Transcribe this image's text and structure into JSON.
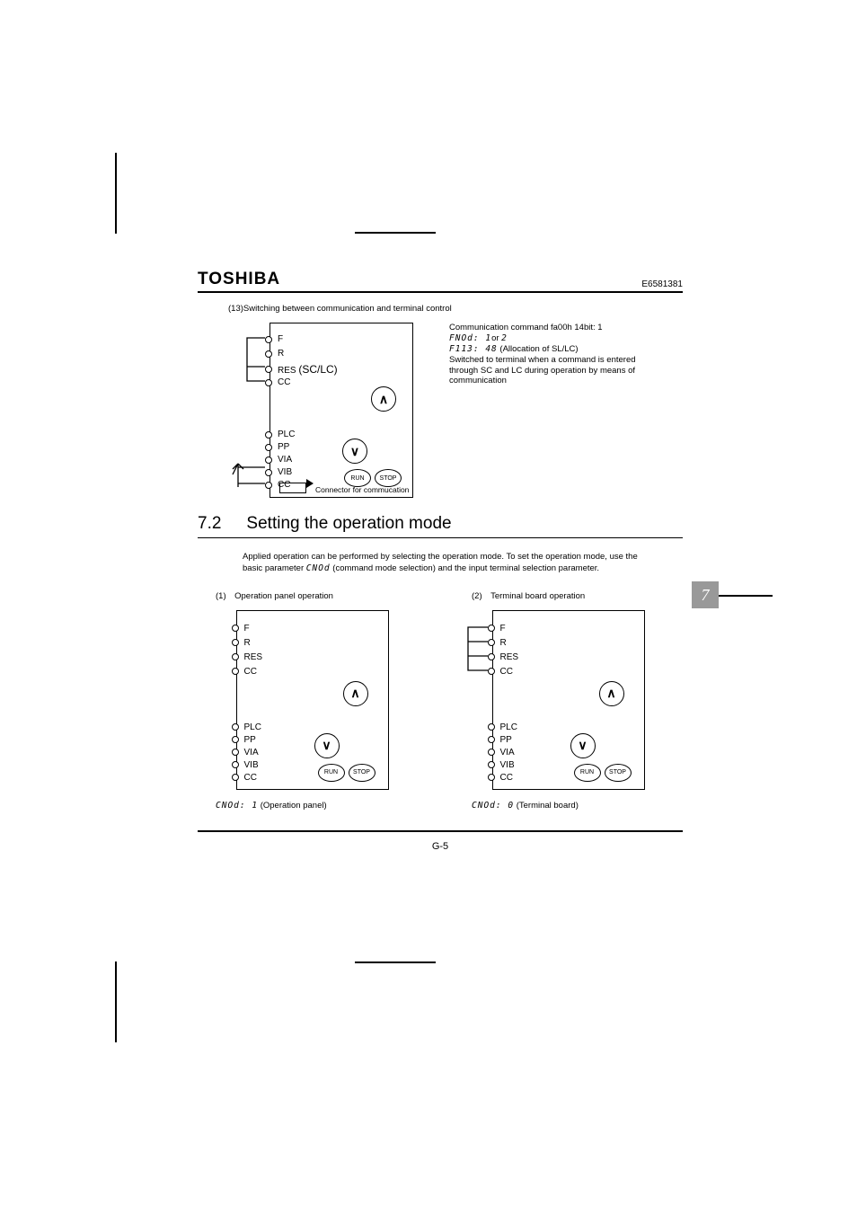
{
  "header": {
    "logo": "TOSHIBA",
    "docnum": "E6581381"
  },
  "side_tab": "7",
  "sect13_title": "(13)Switching between communication and terminal control",
  "dev13": {
    "t1": "F",
    "t2": "R",
    "t3": "RES",
    "t3b": "(SC/LC)",
    "t4": "CC",
    "t5": "PLC",
    "t6": "PP",
    "t7": "VIA",
    "t8": "VIB",
    "t9": "CC",
    "btn_run": "RUN",
    "btn_stop": "STOP",
    "conn": "Connector for commucation"
  },
  "note13": {
    "l1": "Communication command fa00h 14bit: 1",
    "l2a": "FNOd",
    "l2b": ": 1",
    "l2c": "or",
    "l2d": "2",
    "l3a": "F113",
    "l3b": ": 48",
    "l3c": " (Allocation of SL/LC)",
    "l4": "Switched to terminal when a command is entered through SC and LC during operation by means of communication"
  },
  "h2": {
    "num": "7.2",
    "txt": "Setting the operation mode"
  },
  "para": {
    "p1a": "Applied operation can be performed by selecting the operation mode. To set the operation mode, use the basic parameter ",
    "p1b": "CNOd",
    "p1c": " (command mode selection) and the input terminal selection parameter."
  },
  "col1_title": "(1) Operation panel operation",
  "col2_title": "(2) Terminal board operation",
  "dev_generic": {
    "t1": "F",
    "t2": "R",
    "t3": "RES",
    "t4": "CC",
    "t5": "PLC",
    "t6": "PP",
    "t7": "VIA",
    "t8": "VIB",
    "t9": "CC",
    "btn_run": "RUN",
    "btn_stop": "STOP"
  },
  "cap1a": "CNOd",
  "cap1b": ": 1",
  "cap1c": " (Operation panel)",
  "cap2a": "CNOd",
  "cap2b": ": 0",
  "cap2c": " (Terminal board)",
  "page_num": "G-5"
}
